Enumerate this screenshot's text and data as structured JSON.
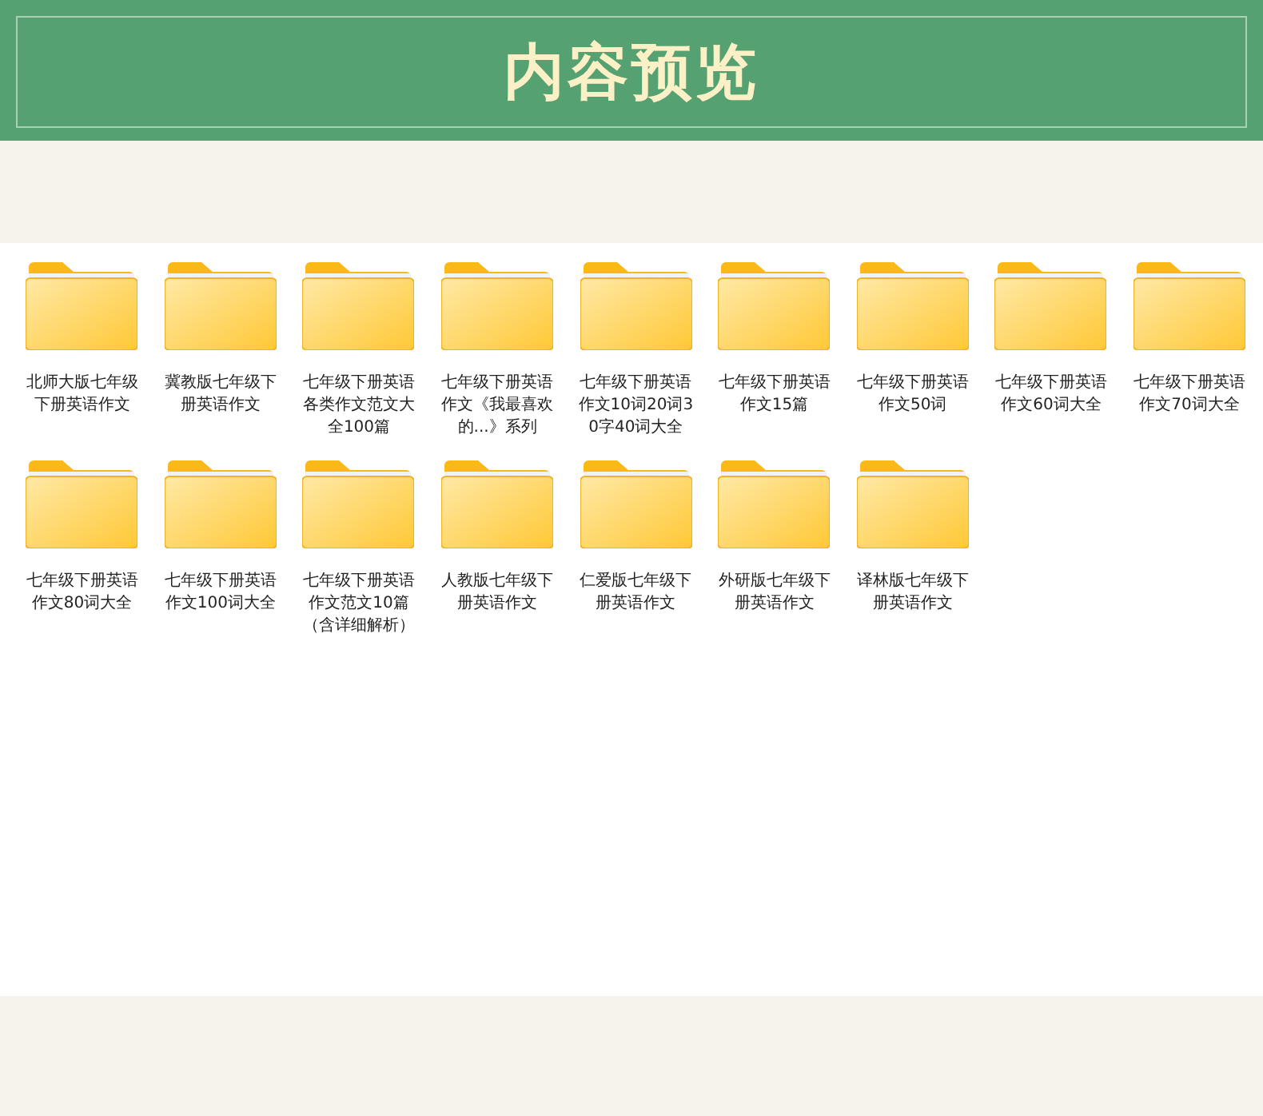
{
  "header": {
    "title": "内容预览"
  },
  "folders": [
    {
      "name": "北师大版七年级下册英语作文"
    },
    {
      "name": "冀教版七年级下册英语作文"
    },
    {
      "name": "七年级下册英语各类作文范文大全100篇"
    },
    {
      "name": "七年级下册英语作文《我最喜欢的...》系列"
    },
    {
      "name": "七年级下册英语作文10词20词30字40词大全"
    },
    {
      "name": "七年级下册英语作文15篇"
    },
    {
      "name": "七年级下册英语作文50词"
    },
    {
      "name": "七年级下册英语作文60词大全"
    },
    {
      "name": "七年级下册英语作文70词大全"
    },
    {
      "name": "七年级下册英语作文80词大全"
    },
    {
      "name": "七年级下册英语作文100词大全"
    },
    {
      "name": "七年级下册英语作文范文10篇（含详细解析）"
    },
    {
      "name": "人教版七年级下册英语作文"
    },
    {
      "name": "仁爱版七年级下册英语作文"
    },
    {
      "name": "外研版七年级下册英语作文"
    },
    {
      "name": "译林版七年级下册英语作文"
    }
  ]
}
